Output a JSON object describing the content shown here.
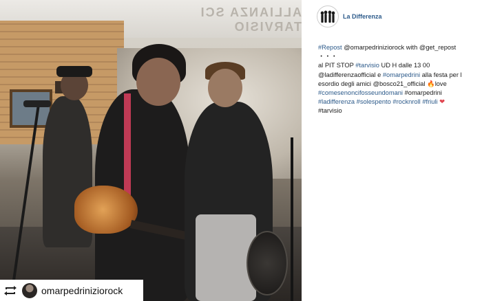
{
  "post": {
    "account_name": "La Differenza",
    "repost_username": "omarpedriniziorock",
    "caption_lines": [
      [
        {
          "t": "#Repost",
          "tag": true
        },
        {
          "t": " @omarpedriniziorock with @get_repost",
          "tag": false
        }
      ],
      [
        {
          "t": "・・・",
          "tag": false
        }
      ],
      [
        {
          "t": "al PIT STOP ",
          "tag": false
        },
        {
          "t": "#tarvisio",
          "tag": true
        },
        {
          "t": " UD H dalle 13 00",
          "tag": false
        }
      ],
      [
        {
          "t": "@ladifferenzaofficial e ",
          "tag": false
        },
        {
          "t": "#omarpedrini",
          "tag": true
        },
        {
          "t": " alla festa per l",
          "tag": false
        }
      ],
      [
        {
          "t": "esordio degli amici @bosco21_official ",
          "tag": false
        },
        {
          "t": "🔥",
          "tag": false,
          "cls": "flame"
        },
        {
          "t": "love",
          "tag": false
        }
      ],
      [
        {
          "t": "#comesenoncifosseundomani",
          "tag": true
        },
        {
          "t": " #omarpedrini",
          "tag": false
        }
      ],
      [
        {
          "t": "#ladifferenza",
          "tag": true
        },
        {
          "t": " ",
          "tag": false
        },
        {
          "t": "#solespento",
          "tag": true
        },
        {
          "t": " ",
          "tag": false
        },
        {
          "t": "#rocknroll",
          "tag": true
        },
        {
          "t": " ",
          "tag": false
        },
        {
          "t": "#friuli",
          "tag": true
        },
        {
          "t": " ❤",
          "tag": false,
          "cls": "heart"
        }
      ],
      [
        {
          "t": "#tarvisio",
          "tag": false
        }
      ]
    ]
  },
  "photo": {
    "tent_text": "ALLIANZA SCI TARVISIO"
  },
  "colors": {
    "link": "#2c5a8a",
    "heart": "#e0454f"
  },
  "icons": [
    "repost-icon",
    "avatar",
    "logo"
  ]
}
